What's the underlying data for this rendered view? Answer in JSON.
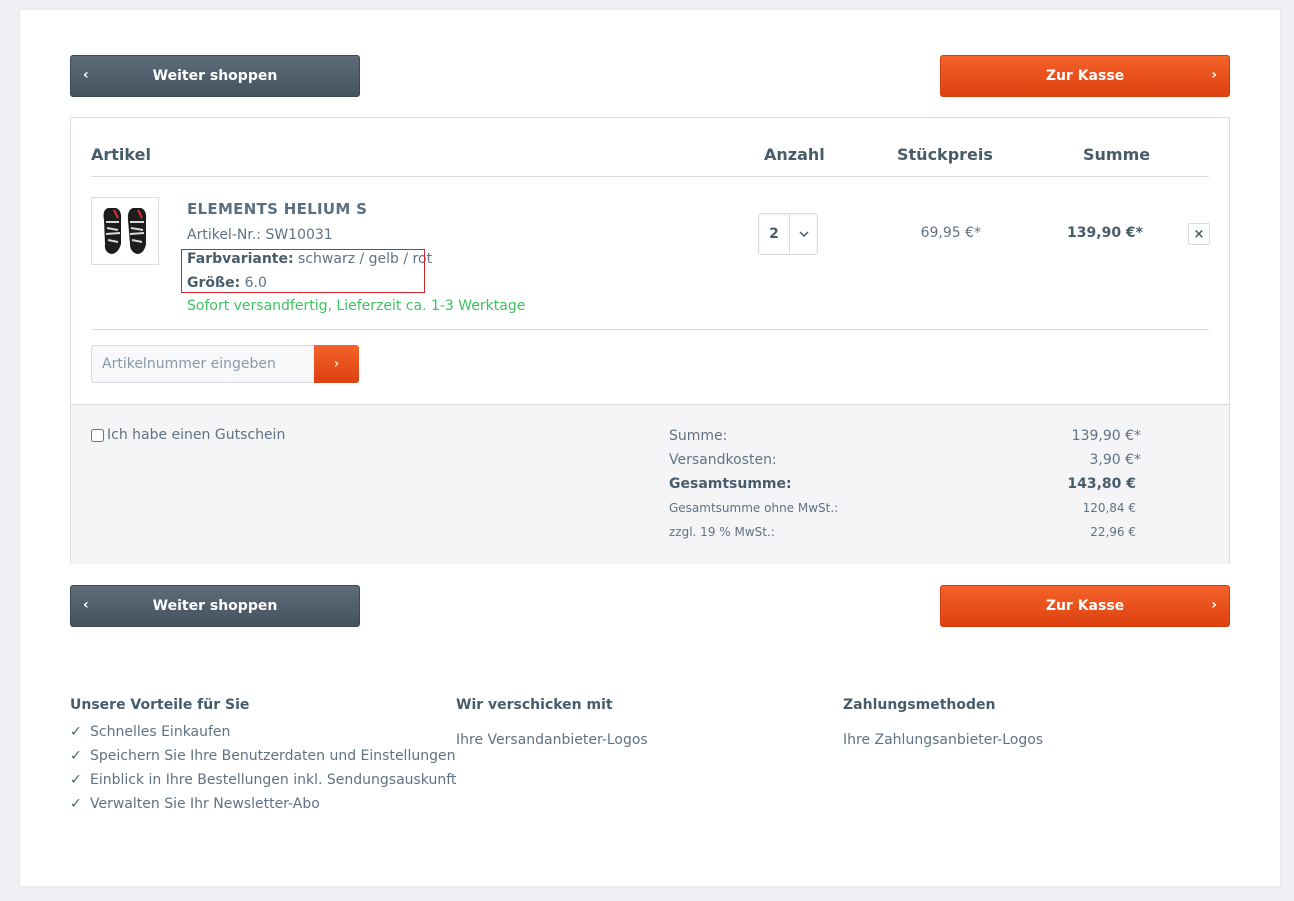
{
  "nav": {
    "continue_label": "Weiter shoppen",
    "checkout_label": "Zur Kasse"
  },
  "table": {
    "headers": {
      "article": "Artikel",
      "quantity": "Anzahl",
      "unit_price": "Stückpreis",
      "sum": "Summe"
    }
  },
  "item": {
    "title": "ELEMENTS HELIUM S",
    "sku_label": "Artikel-Nr.:",
    "sku": "SW10031",
    "variant_label": "Farbvariante:",
    "variant": "schwarz / gelb / rot",
    "size_label": "Größe:",
    "size": "6.0",
    "availability": "Sofort versandfertig, Lieferzeit ca. 1-3 Werktage",
    "quantity": "2",
    "unit_price": "69,95 €*",
    "total": "139,90 €*",
    "remove_label": "×",
    "image_icon": "glove-icon"
  },
  "add_article": {
    "placeholder": "Artikelnummer eingeben",
    "submit_icon": "chevron-right-icon"
  },
  "voucher": {
    "label": "Ich habe einen Gutschein",
    "checked": false
  },
  "summary": {
    "rows": [
      {
        "label": "Summe:",
        "value": "139,90 €*"
      },
      {
        "label": "Versandkosten:",
        "value": "3,90 €*"
      },
      {
        "label": "Gesamtsumme:",
        "value": "143,80 €"
      },
      {
        "label": "Gesamtsumme ohne MwSt.:",
        "value": "120,84 €"
      },
      {
        "label": "zzgl. 19 % MwSt.:",
        "value": "22,96 €"
      }
    ]
  },
  "footer": {
    "advantages": {
      "title": "Unsere Vorteile für Sie",
      "items": [
        "Schnelles Einkaufen",
        "Speichern Sie Ihre Benutzerdaten und Einstellungen",
        "Einblick in Ihre Bestellungen inkl. Sendungsauskunft",
        "Verwalten Sie Ihr Newsletter-Abo"
      ]
    },
    "shipping": {
      "title": "Wir verschicken mit",
      "text": "Ihre Versandanbieter-Logos"
    },
    "payment": {
      "title": "Zahlungsmethoden",
      "text": "Ihre Zahlungsanbieter-Logos"
    }
  },
  "colors": {
    "accent": "#e8501a",
    "dark_button": "#4f5d6a",
    "success": "#3cc261",
    "highlight_border": "#d2232a"
  }
}
